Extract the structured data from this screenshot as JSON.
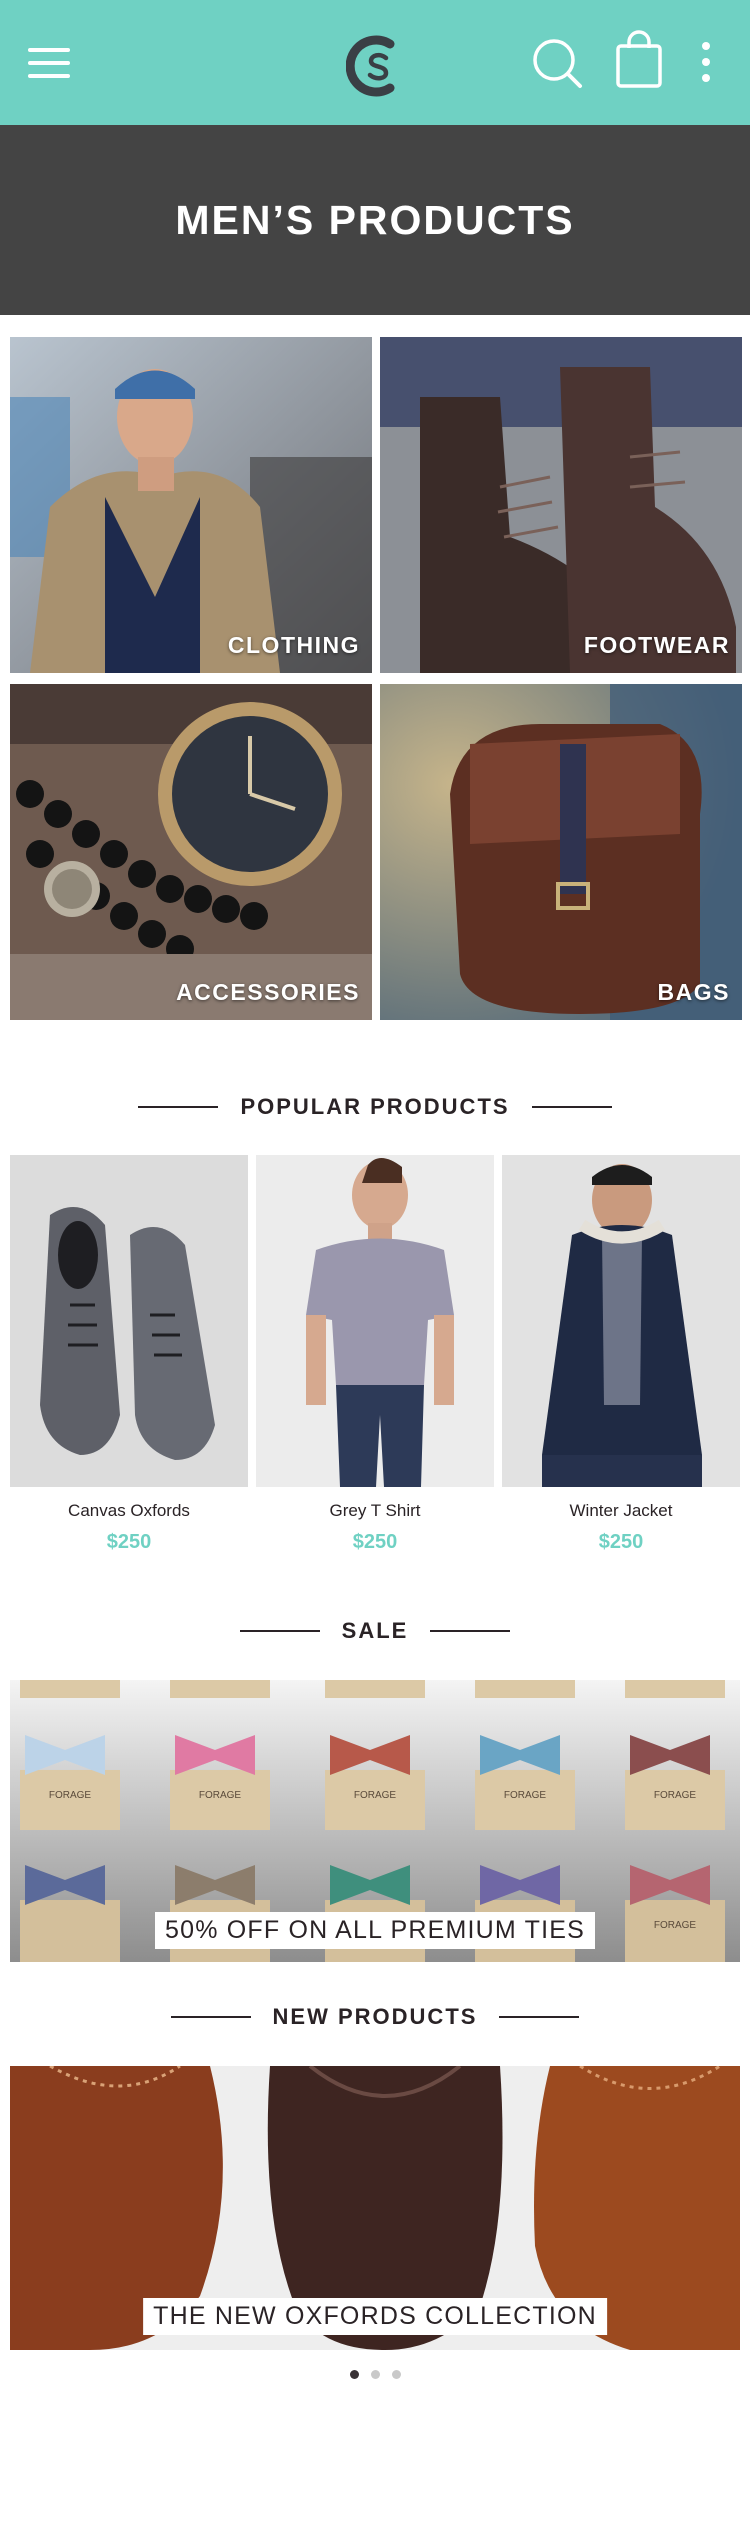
{
  "header": {
    "menu_icon": "hamburger-icon",
    "logo_icon": "cs-logo-icon",
    "search_icon": "search-icon",
    "bag_icon": "shopping-bag-icon",
    "more_icon": "more-vertical-icon",
    "bar_color": "#6fd1c3"
  },
  "hero": {
    "title": "MEN’S PRODUCTS",
    "bg_color": "#444444"
  },
  "categories": [
    {
      "label": "CLOTHING"
    },
    {
      "label": "FOOTWEAR"
    },
    {
      "label": "ACCESSORIES"
    },
    {
      "label": "BAGS"
    }
  ],
  "popular": {
    "title": "POPULAR PRODUCTS",
    "products": [
      {
        "name": "Canvas Oxfords",
        "price": "$250"
      },
      {
        "name": "Grey T Shirt",
        "price": "$250"
      },
      {
        "name": "Winter Jacket",
        "price": "$250"
      }
    ]
  },
  "sale": {
    "title": "SALE",
    "banner_caption": "50% OFF ON ALL PREMIUM TIES",
    "box_brand": "FORAGE"
  },
  "new_products": {
    "title": "NEW PRODUCTS",
    "banner_caption": "THE NEW OXFORDS COLLECTION"
  },
  "carousel": {
    "pages": 3,
    "active": 1
  },
  "accent_color": "#6fd1c3"
}
